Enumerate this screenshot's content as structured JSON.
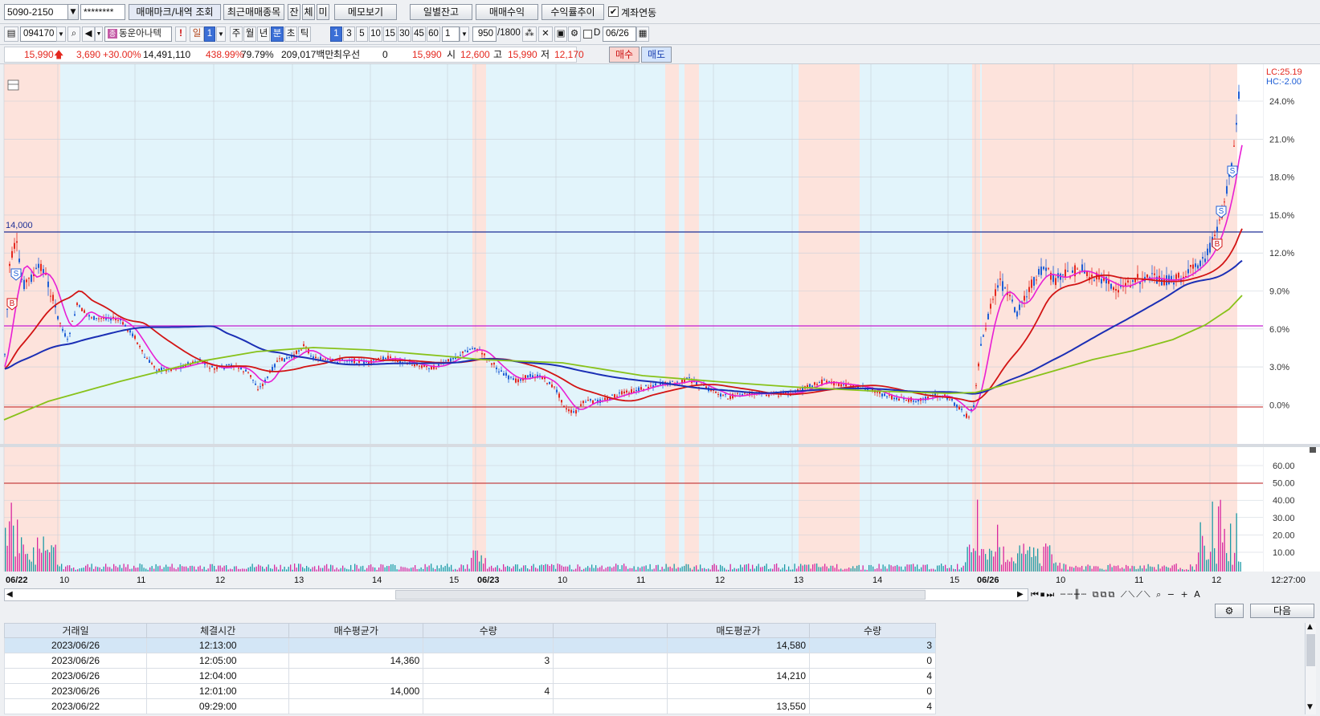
{
  "account": {
    "number": "5090-2150",
    "password": "********",
    "trade_mark_btn": "매매마크/내역 조회",
    "recent_btn": "최근매매종목",
    "mini_btns": [
      "잔",
      "체",
      "미"
    ],
    "memo_btn": "메모보기",
    "daily_btn": "일별잔고",
    "profit_btn": "매매수익",
    "return_btn": "수익률추이",
    "link_label": "계좌연동",
    "link_checked": true
  },
  "toolbar": {
    "code": "094170",
    "stock_name": "동운아나텍",
    "alert": "!",
    "period_il": "일",
    "period_num": "1",
    "periods": [
      "주",
      "월",
      "년",
      "분",
      "초",
      "틱"
    ],
    "selected_period": "분",
    "intervals": [
      "1",
      "3",
      "5",
      "10",
      "15",
      "30",
      "45",
      "60"
    ],
    "selected_interval": "1",
    "multiplier": "1",
    "count": "950",
    "count_max": "/1800",
    "d_label": "D",
    "date": "06/26"
  },
  "quote": {
    "price": "15,990",
    "change": "3,690",
    "change_pct": "+30.00%",
    "volume": "14,491,110",
    "vol_ratio": "438.99%",
    "turnover": "79.79%",
    "amount": "209,017백만",
    "priority": "최우선",
    "priority_val": "0",
    "last": "15,990",
    "open_label": "시",
    "open": "12,600",
    "high_label": "고",
    "high": "15,990",
    "low_label": "저",
    "low": "12,170",
    "buy": "매수",
    "sell": "매도"
  },
  "chart": {
    "lc": "LC:25.19",
    "hc": "HC:-2.00",
    "level_label": "14,000",
    "y_ticks": [
      "24.0%",
      "21.0%",
      "18.0%",
      "15.0%",
      "12.0%",
      "9.0%",
      "6.0%",
      "3.0%",
      "0.0%"
    ],
    "vol_ticks": [
      "60.00",
      "50.00",
      "40.00",
      "30.00",
      "20.00",
      "10.00"
    ],
    "x_labels": [
      {
        "t": "06/22",
        "bold": true
      },
      {
        "t": "10"
      },
      {
        "t": "11"
      },
      {
        "t": "12"
      },
      {
        "t": "13"
      },
      {
        "t": "14"
      },
      {
        "t": "15"
      },
      {
        "t": "06/23",
        "bold": true
      },
      {
        "t": "10"
      },
      {
        "t": "11"
      },
      {
        "t": "12"
      },
      {
        "t": "13"
      },
      {
        "t": "14"
      },
      {
        "t": "15"
      },
      {
        "t": "06/26",
        "bold": true
      },
      {
        "t": "10"
      },
      {
        "t": "11"
      },
      {
        "t": "12"
      }
    ],
    "time": "12:27:00",
    "marks": [
      {
        "t": "S"
      },
      {
        "t": "B"
      },
      {
        "t": "S"
      },
      {
        "t": "S"
      },
      {
        "t": "B"
      }
    ],
    "colors": {
      "up": "#e4281f",
      "down": "#1f5fd6",
      "ma5": "#e81ed4",
      "ma20": "#d21414",
      "ma60": "#1b2fb5",
      "ma120": "#88c21a",
      "level": "#1d2f96",
      "hline": "#c41ed1",
      "zero": "#c01e1e",
      "buy_bg": "#fde3dc",
      "sell_bg": "#e2f4fb"
    }
  },
  "next_btn": "다음",
  "grid": {
    "headers": [
      "거래일",
      "체결시간",
      "매수평균가",
      "수량",
      "",
      "매도평균가",
      "수량"
    ],
    "rows": [
      [
        "2023/06/26",
        "12:13:00",
        "",
        "",
        "",
        "14,580",
        "3"
      ],
      [
        "2023/06/26",
        "12:05:00",
        "14,360",
        "3",
        "",
        "",
        "0"
      ],
      [
        "2023/06/26",
        "12:04:00",
        "",
        "",
        "",
        "14,210",
        "4"
      ],
      [
        "2023/06/26",
        "12:01:00",
        "14,000",
        "4",
        "",
        "",
        "0"
      ],
      [
        "2023/06/22",
        "09:29:00",
        "",
        "",
        "",
        "13,550",
        "4"
      ]
    ]
  }
}
